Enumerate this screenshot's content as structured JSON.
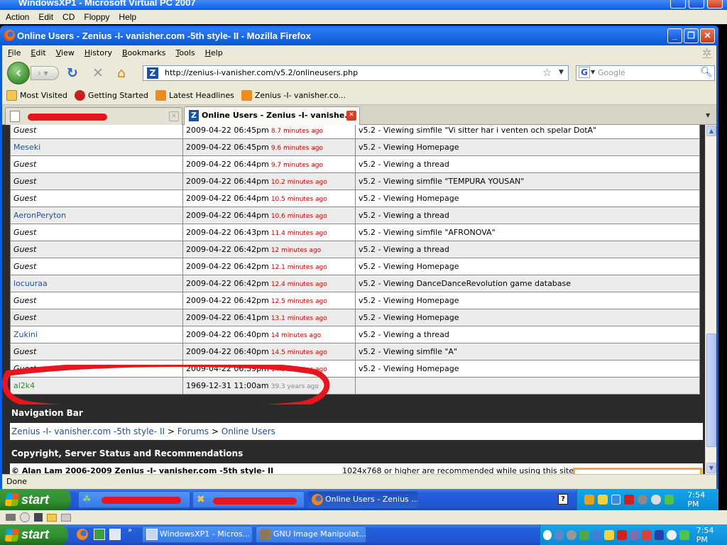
{
  "vpc": {
    "title": "WindowsXP1 - Microsoft Virtual PC 2007",
    "menu": [
      "Action",
      "Edit",
      "CD",
      "Floppy",
      "Help"
    ]
  },
  "firefox": {
    "title": "Online Users - Zenius -I- vanisher.com -5th style- II - Mozilla Firefox",
    "menu": [
      "File",
      "Edit",
      "View",
      "History",
      "Bookmarks",
      "Tools",
      "Help"
    ],
    "url": "http://zenius-i-vanisher.com/v5.2/onlineusers.php",
    "search_placeholder": "Google",
    "bookmarks": [
      "Most Visited",
      "Getting Started",
      "Latest Headlines",
      "Zenius -I- vanisher.co..."
    ],
    "tabs": [
      {
        "label": ""
      },
      {
        "label": "Online Users - Zenius -I- vanishe..."
      }
    ],
    "status": "Done"
  },
  "users_table": {
    "rows": [
      {
        "name": "Guest",
        "type": "guest",
        "time": "2009-04-22 06:45pm",
        "ago": "8.7 minutes ago",
        "activity": "v5.2 - Viewing simfile \"Vi sitter har i venten och spelar DotA\""
      },
      {
        "name": "Meseki",
        "type": "member",
        "time": "2009-04-22 06:45pm",
        "ago": "9.6 minutes ago",
        "activity": "v5.2 - Viewing Homepage"
      },
      {
        "name": "Guest",
        "type": "guest",
        "time": "2009-04-22 06:44pm",
        "ago": "9.7 minutes ago",
        "activity": "v5.2 - Viewing a thread"
      },
      {
        "name": "Guest",
        "type": "guest",
        "time": "2009-04-22 06:44pm",
        "ago": "10.2 minutes ago",
        "activity": "v5.2 - Viewing simfile \"TEMPURA YOUSAN\""
      },
      {
        "name": "Guest",
        "type": "guest",
        "time": "2009-04-22 06:44pm",
        "ago": "10.5 minutes ago",
        "activity": "v5.2 - Viewing Homepage"
      },
      {
        "name": "AeronPeryton",
        "type": "member",
        "time": "2009-04-22 06:44pm",
        "ago": "10.6 minutes ago",
        "activity": "v5.2 - Viewing a thread"
      },
      {
        "name": "Guest",
        "type": "guest",
        "time": "2009-04-22 06:43pm",
        "ago": "11.4 minutes ago",
        "activity": "v5.2 - Viewing simfile \"AFRONOVA\""
      },
      {
        "name": "Guest",
        "type": "guest",
        "time": "2009-04-22 06:42pm",
        "ago": "12 minutes ago",
        "activity": "v5.2 - Viewing a thread"
      },
      {
        "name": "Guest",
        "type": "guest",
        "time": "2009-04-22 06:42pm",
        "ago": "12.1 minutes ago",
        "activity": "v5.2 - Viewing Homepage"
      },
      {
        "name": "locuuraa",
        "type": "member",
        "time": "2009-04-22 06:42pm",
        "ago": "12.4 minutes ago",
        "activity": "v5.2 - Viewing DanceDanceRevolution game database"
      },
      {
        "name": "Guest",
        "type": "guest",
        "time": "2009-04-22 06:42pm",
        "ago": "12.5 minutes ago",
        "activity": "v5.2 - Viewing Homepage"
      },
      {
        "name": "Guest",
        "type": "guest",
        "time": "2009-04-22 06:41pm",
        "ago": "13.1 minutes ago",
        "activity": "v5.2 - Viewing Homepage"
      },
      {
        "name": "Zukini",
        "type": "member",
        "time": "2009-04-22 06:40pm",
        "ago": "14 minutes ago",
        "activity": "v5.2 - Viewing a thread"
      },
      {
        "name": "Guest",
        "type": "guest",
        "time": "2009-04-22 06:40pm",
        "ago": "14.5 minutes ago",
        "activity": "v5.2 - Viewing simfile \"A\""
      },
      {
        "name": "Guest",
        "type": "guest",
        "time": "2009-04-22 06:39pm",
        "ago": "14.9 minutes ago",
        "activity": "v5.2 - Viewing Homepage"
      },
      {
        "name": "al2k4",
        "type": "special",
        "time": "1969-12-31 11:00am",
        "ago": "39.3 years ago",
        "activity": ""
      }
    ]
  },
  "navigation": {
    "heading": "Navigation Bar",
    "breadcrumb": [
      "Zenius -I- vanisher.com -5th style- II",
      "Forums",
      "Online Users"
    ],
    "separator": ">"
  },
  "copyright": {
    "heading": "Copyright, Server Status and Recommendations",
    "text": "© Alan Lam 2006-2009 Zenius -I- vanisher.com -5th style- II",
    "recommend": "1024x768 or higher are recommended while using this site"
  },
  "guest_taskbar": {
    "start": "start",
    "tasks": [
      "",
      "",
      "Online Users - Zenius ..."
    ],
    "clock": "7:54 PM"
  },
  "host_taskbar": {
    "start": "start",
    "tasks": [
      "WindowsXP1 - Micros...",
      "GNU Image Manipulat..."
    ],
    "clock": "7:54 PM"
  },
  "colors": {
    "xp_blue": "#245edb",
    "start_green": "#2f8f2f",
    "ago_red": "#c20000",
    "member_blue": "#1f4fa0",
    "highlight_red": "#e8141e"
  }
}
